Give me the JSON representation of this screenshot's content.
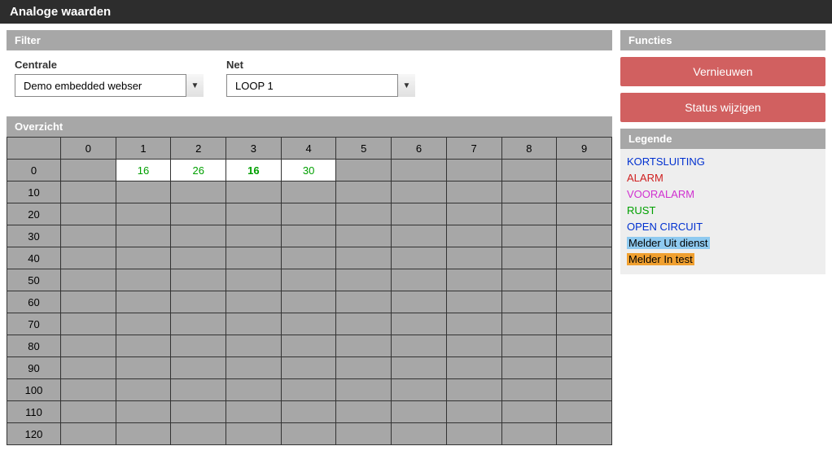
{
  "title": "Analoge waarden",
  "filter": {
    "header": "Filter",
    "centrale": {
      "label": "Centrale",
      "value": "Demo embedded webser"
    },
    "net": {
      "label": "Net",
      "value": "LOOP 1"
    }
  },
  "overzicht": {
    "header": "Overzicht",
    "columns": [
      "0",
      "1",
      "2",
      "3",
      "4",
      "5",
      "6",
      "7",
      "8",
      "9"
    ],
    "rows": [
      "0",
      "10",
      "20",
      "30",
      "40",
      "50",
      "60",
      "70",
      "80",
      "90",
      "100",
      "110",
      "120"
    ],
    "cells": {
      "0": {
        "1": {
          "value": "16",
          "bold": false
        },
        "2": {
          "value": "26",
          "bold": false
        },
        "3": {
          "value": "16",
          "bold": true
        },
        "4": {
          "value": "30",
          "bold": false
        }
      }
    }
  },
  "functies": {
    "header": "Functies",
    "btn_refresh": "Vernieuwen",
    "btn_status": "Status wijzigen"
  },
  "legende": {
    "header": "Legende",
    "items": [
      {
        "label": "KORTSLUITING",
        "cls": "leg-kortsluiting"
      },
      {
        "label": "ALARM",
        "cls": "leg-alarm"
      },
      {
        "label": "VOORALARM",
        "cls": "leg-vooralarm"
      },
      {
        "label": "RUST",
        "cls": "leg-rust"
      },
      {
        "label": "OPEN CIRCUIT",
        "cls": "leg-opencircuit"
      },
      {
        "label": "Melder Uit dienst",
        "cls": "leg-uitdienst"
      },
      {
        "label": "Melder In test",
        "cls": "leg-intest"
      }
    ]
  }
}
